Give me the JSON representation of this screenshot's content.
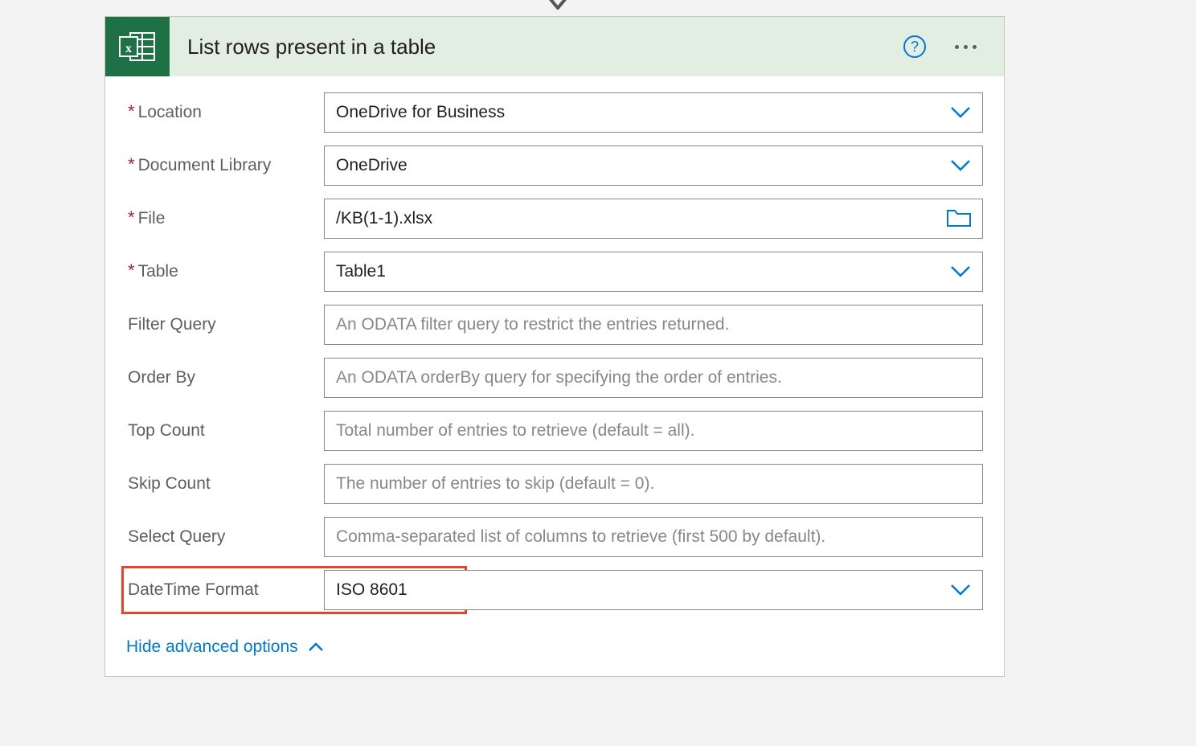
{
  "header": {
    "title": "List rows present in a table"
  },
  "fields": {
    "location": {
      "label": "Location",
      "value": "OneDrive for Business"
    },
    "library": {
      "label": "Document Library",
      "value": "OneDrive"
    },
    "file": {
      "label": "File",
      "value": "/KB(1-1).xlsx"
    },
    "table": {
      "label": "Table",
      "value": "Table1"
    },
    "filter": {
      "label": "Filter Query",
      "placeholder": "An ODATA filter query to restrict the entries returned."
    },
    "orderby": {
      "label": "Order By",
      "placeholder": "An ODATA orderBy query for specifying the order of entries."
    },
    "top": {
      "label": "Top Count",
      "placeholder": "Total number of entries to retrieve (default = all)."
    },
    "skip": {
      "label": "Skip Count",
      "placeholder": "The number of entries to skip (default = 0)."
    },
    "select": {
      "label": "Select Query",
      "placeholder": "Comma-separated list of columns to retrieve (first 500 by default)."
    },
    "dtformat": {
      "label": "DateTime Format",
      "value": "ISO 8601"
    }
  },
  "footer": {
    "toggle": "Hide advanced options"
  }
}
